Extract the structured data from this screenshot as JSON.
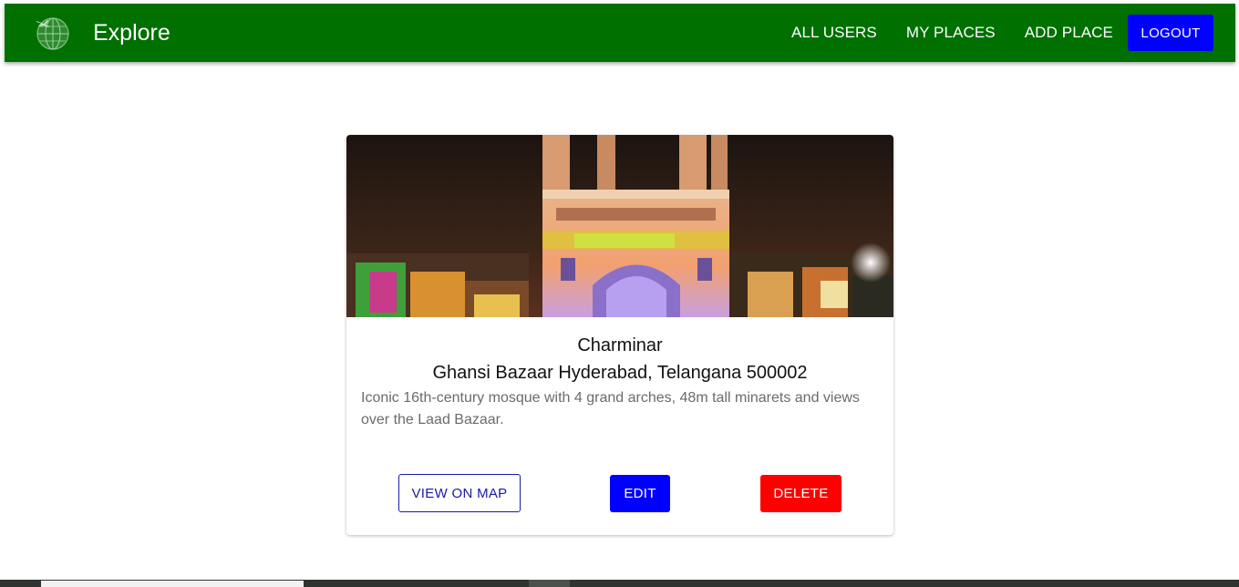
{
  "header": {
    "brand": "Explore",
    "logo_icon": "globe-airplane-icon",
    "nav": [
      "ALL USERS",
      "MY PLACES",
      "ADD PLACE"
    ],
    "logout_label": "LOGOUT"
  },
  "place": {
    "title": "Charminar",
    "address": "Ghansi Bazaar Hyderabad, Telangana 500002",
    "description": "Iconic 16th-century mosque with 4 grand arches, 48m tall minarets and views over the Laad Bazaar.",
    "image_alt": "Charminar",
    "buttons": {
      "view_map": "VIEW ON MAP",
      "edit": "EDIT",
      "delete": "DELETE"
    }
  },
  "colors": {
    "navbar": "#007000",
    "primary": "#0000ff",
    "danger": "#ff0000",
    "outline": "#1a1aa8"
  }
}
